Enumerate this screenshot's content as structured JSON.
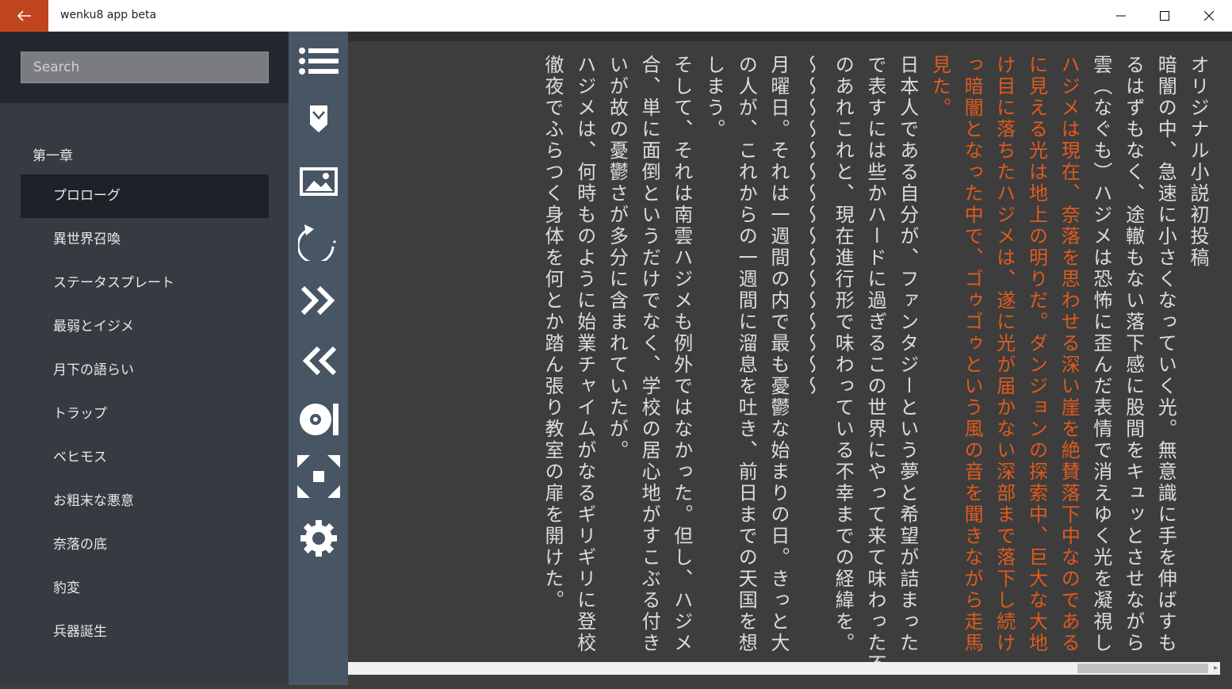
{
  "window": {
    "title": "wenku8 app beta",
    "accent_color": "#c1451c",
    "controls": [
      "minimize-icon",
      "maximize-icon",
      "close-icon"
    ]
  },
  "sidebar": {
    "search_placeholder": "Search",
    "chapter_title": "第一章",
    "items": [
      {
        "label": "プロローグ",
        "selected": true
      },
      {
        "label": "異世界召喚"
      },
      {
        "label": "ステータスプレート"
      },
      {
        "label": "最弱とイジメ"
      },
      {
        "label": "月下の語らい"
      },
      {
        "label": "トラップ"
      },
      {
        "label": "ベヒモス"
      },
      {
        "label": "お粗末な悪意"
      },
      {
        "label": "奈落の底"
      },
      {
        "label": "豹変"
      },
      {
        "label": "兵器誕生"
      }
    ]
  },
  "toolbar": {
    "icons": [
      "list-icon",
      "bookmark-icon",
      "image-icon",
      "refresh-icon",
      "next-chapter-icon",
      "previous-chapter-icon",
      "disc-icon",
      "fullscreen-icon",
      "settings-icon"
    ]
  },
  "reader": {
    "highlight_color": "#e05a1e",
    "columns": [
      {
        "text": "オリジナル小説初投稿",
        "highlight": false
      },
      {
        "text": "暗闇の中、急速に小さくなっていく光。無意識に手を伸ばすも",
        "highlight": false
      },
      {
        "text": "るはずもなく、途轍もない落下感に股間をキュッとさせながら",
        "highlight": false
      },
      {
        "text": "雲（なぐも）ハジメは恐怖に歪んだ表情で消えゆく光を凝視し",
        "highlight": false
      },
      {
        "text": "ハジメは現在、奈落を思わせる深い崖を絶賛落下中なのである",
        "highlight": true
      },
      {
        "text": "に見える光は地上の明りだ。ダンジョンの探索中、巨大な大地",
        "highlight": true
      },
      {
        "text": "け目に落ちたハジメは、遂に光が届かない深部まで落下し続け",
        "highlight": true
      },
      {
        "text": "っ暗闇となった中で、ゴゥゴゥという風の音を聞きながら走馬",
        "highlight": true
      },
      {
        "text": "見た。",
        "highlight": true
      },
      {
        "text": "日本人である自分が、ファンタジーという夢と希望が詰まった",
        "highlight": false
      },
      {
        "text": "で表すには些かハードに過ぎるこの世界にやって来て味わった不",
        "highlight": false
      },
      {
        "text": "のあれこれと、現在進行形で味わっている不幸までの経緯を。",
        "highlight": false
      },
      {
        "text": "～～～～～～～～～～～～～～～～",
        "highlight": false
      },
      {
        "text": "月曜日。それは一週間の内で最も憂鬱な始まりの日。きっと大",
        "highlight": false
      },
      {
        "text": "の人が、これからの一週間に溜息を吐き、前日までの天国を想",
        "highlight": false
      },
      {
        "text": "しまう。",
        "highlight": false
      },
      {
        "text": "そして、それは南雲ハジメも例外ではなかった。但し、ハジメ",
        "highlight": false
      },
      {
        "text": "合、単に面倒というだけでなく、学校の居心地がすこぶる付き",
        "highlight": false
      },
      {
        "text": "いが故の憂鬱さが多分に含まれていたが。",
        "highlight": false
      },
      {
        "text": "ハジメは、何時ものように始業チャイムがなるギリギリに登校",
        "highlight": false
      },
      {
        "text": "徹夜でふらつく身体を何とか踏ん張り教室の扉を開けた。",
        "highlight": false
      }
    ]
  }
}
